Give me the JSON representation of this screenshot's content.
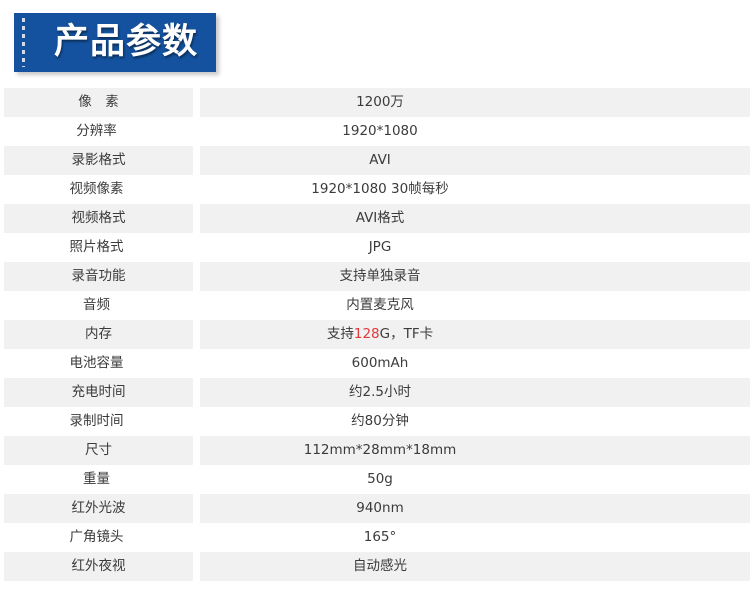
{
  "header": {
    "title": "产品参数",
    "banner_color": "#14529f",
    "title_color": "#ffffff"
  },
  "table": {
    "shade_color": "#f1f1f1",
    "plain_color": "#ffffff",
    "text_color": "#3b3b3b",
    "highlight_color": "#e2383c",
    "rows": [
      {
        "label": "像　素",
        "value": "1200万"
      },
      {
        "label": "分辨率",
        "value": "1920*1080"
      },
      {
        "label": "录影格式",
        "value": "AVI"
      },
      {
        "label": "视频像素",
        "value": "1920*1080  30帧每秒"
      },
      {
        "label": "视频格式",
        "value": "AVI格式"
      },
      {
        "label": "照片格式",
        "value": "JPG"
      },
      {
        "label": "录音功能",
        "value": "支持单独录音"
      },
      {
        "label": "音频",
        "value": "内置麦克风"
      },
      {
        "label": "内存",
        "value": "支持128G，TF卡",
        "value_prefix": "支持",
        "value_highlight": "128",
        "value_suffix": "G，TF卡"
      },
      {
        "label": "电池容量",
        "value": "600mAh"
      },
      {
        "label": "充电时间",
        "value": "约2.5小时"
      },
      {
        "label": "录制时间",
        "value": "约80分钟"
      },
      {
        "label": "尺寸",
        "value": "112mm*28mm*18mm"
      },
      {
        "label": "重量",
        "value": "50g"
      },
      {
        "label": "红外光波",
        "value": "940nm"
      },
      {
        "label": "广角镜头",
        "value": "165°"
      },
      {
        "label": "红外夜视",
        "value": "自动感光"
      }
    ]
  }
}
